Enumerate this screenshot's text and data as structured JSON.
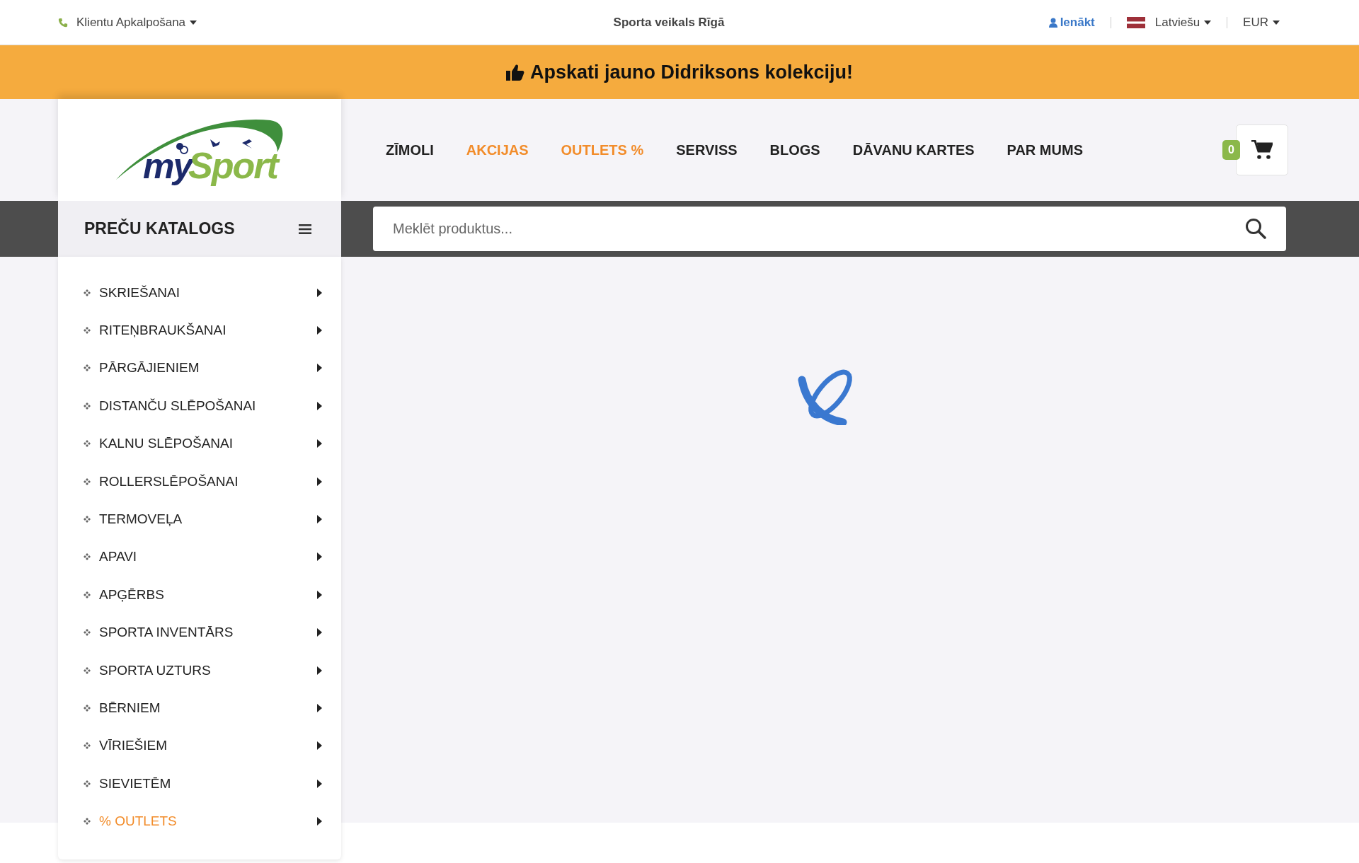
{
  "top_bar": {
    "support": "Klientu Apkalpošana",
    "store": "Sporta veikals Rīgā",
    "login": "Ienākt",
    "language": "Latviešu",
    "currency": "EUR"
  },
  "banner": {
    "text": "Apskati jauno Didriksons kolekciju!"
  },
  "logo": {
    "part_1": "my",
    "part_2": "Sport"
  },
  "nav": [
    {
      "label": "ZĪMOLI",
      "highlight": false
    },
    {
      "label": "AKCIJAS",
      "highlight": true
    },
    {
      "label": "OUTLETS %",
      "highlight": true
    },
    {
      "label": "SERVISS",
      "highlight": false
    },
    {
      "label": "BLOGS",
      "highlight": false
    },
    {
      "label": "DĀVANU KARTES",
      "highlight": false
    },
    {
      "label": "PAR MUMS",
      "highlight": false
    }
  ],
  "cart": {
    "count": "0"
  },
  "catalog": {
    "title": "PREČU KATALOGS",
    "items": [
      {
        "label": "SKRIEŠANAI",
        "highlight": false
      },
      {
        "label": "RITEŅBRAUKŠANAI",
        "highlight": false
      },
      {
        "label": "PĀRGĀJIENIEM",
        "highlight": false
      },
      {
        "label": "DISTANČU SLĒPOŠANAI",
        "highlight": false
      },
      {
        "label": "KALNU SLĒPOŠANAI",
        "highlight": false
      },
      {
        "label": "ROLLERSLĒPOŠANAI",
        "highlight": false
      },
      {
        "label": "TERMOVEĻA",
        "highlight": false
      },
      {
        "label": "APAVI",
        "highlight": false
      },
      {
        "label": "APĢĒRBS",
        "highlight": false
      },
      {
        "label": "SPORTA INVENTĀRS",
        "highlight": false
      },
      {
        "label": "SPORTA UZTURS",
        "highlight": false
      },
      {
        "label": "BĒRNIEM",
        "highlight": false
      },
      {
        "label": "VĪRIEŠIEM",
        "highlight": false
      },
      {
        "label": "SIEVIETĒM",
        "highlight": false
      },
      {
        "label": "% OUTLETS",
        "highlight": true
      }
    ]
  },
  "search": {
    "placeholder": "Meklēt produktus..."
  }
}
